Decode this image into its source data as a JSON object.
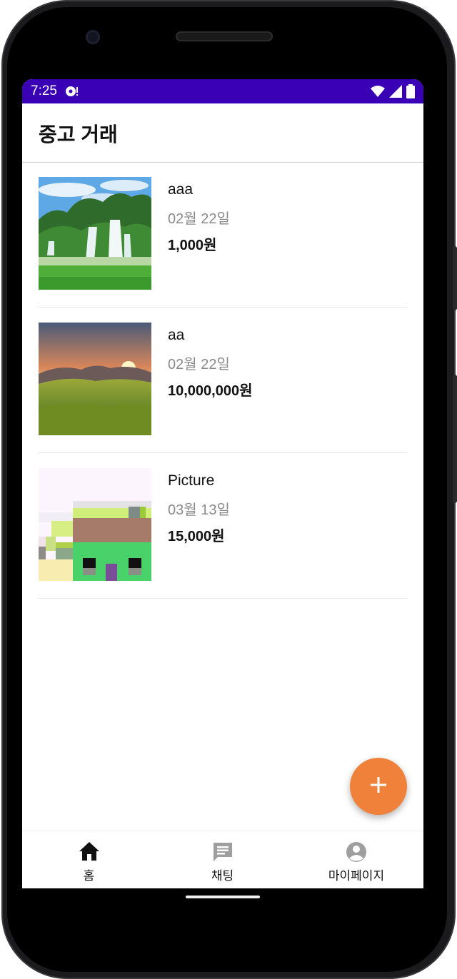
{
  "status_bar": {
    "time": "7:25",
    "icons": [
      "notification-icon",
      "wifi-icon",
      "signal-icon",
      "battery-icon"
    ],
    "background": "#3a00b5"
  },
  "app_bar": {
    "title": "중고 거래"
  },
  "listings": [
    {
      "title": "aaa",
      "date": "02월 22일",
      "price": "1,000원",
      "image": "waterfall-photo"
    },
    {
      "title": "aa",
      "date": "02월 22일",
      "price": "10,000,000원",
      "image": "sunset-meadow-photo"
    },
    {
      "title": "Picture",
      "date": "03월 13일",
      "price": "15,000원",
      "image": "pixel-house-picture"
    }
  ],
  "fab": {
    "icon": "plus-icon",
    "color": "#f0813a"
  },
  "bottom_nav": {
    "items": [
      {
        "label": "홈",
        "icon": "home-icon",
        "active": true
      },
      {
        "label": "채팅",
        "icon": "chat-icon",
        "active": false
      },
      {
        "label": "마이페이지",
        "icon": "account-icon",
        "active": false
      }
    ]
  }
}
